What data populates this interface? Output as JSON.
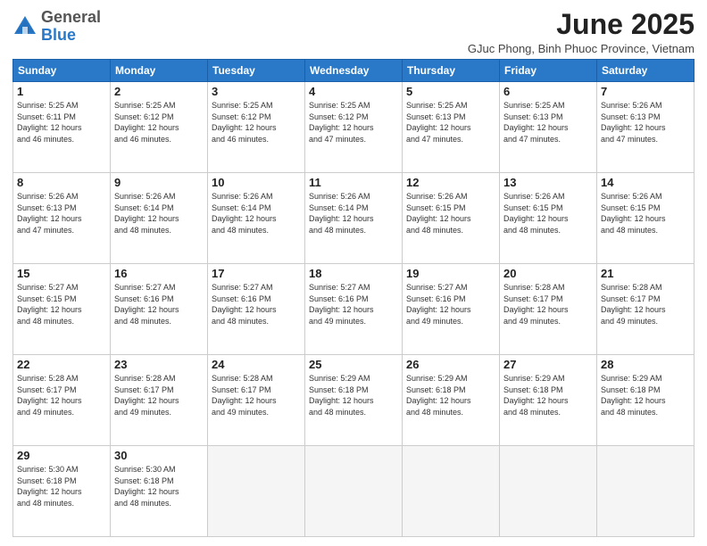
{
  "header": {
    "logo_general": "General",
    "logo_blue": "Blue",
    "month_title": "June 2025",
    "subtitle": "GJuc Phong, Binh Phuoc Province, Vietnam"
  },
  "days_of_week": [
    "Sunday",
    "Monday",
    "Tuesday",
    "Wednesday",
    "Thursday",
    "Friday",
    "Saturday"
  ],
  "weeks": [
    [
      {
        "day": "1",
        "info": "Sunrise: 5:25 AM\nSunset: 6:11 PM\nDaylight: 12 hours\nand 46 minutes."
      },
      {
        "day": "2",
        "info": "Sunrise: 5:25 AM\nSunset: 6:12 PM\nDaylight: 12 hours\nand 46 minutes."
      },
      {
        "day": "3",
        "info": "Sunrise: 5:25 AM\nSunset: 6:12 PM\nDaylight: 12 hours\nand 46 minutes."
      },
      {
        "day": "4",
        "info": "Sunrise: 5:25 AM\nSunset: 6:12 PM\nDaylight: 12 hours\nand 47 minutes."
      },
      {
        "day": "5",
        "info": "Sunrise: 5:25 AM\nSunset: 6:13 PM\nDaylight: 12 hours\nand 47 minutes."
      },
      {
        "day": "6",
        "info": "Sunrise: 5:25 AM\nSunset: 6:13 PM\nDaylight: 12 hours\nand 47 minutes."
      },
      {
        "day": "7",
        "info": "Sunrise: 5:26 AM\nSunset: 6:13 PM\nDaylight: 12 hours\nand 47 minutes."
      }
    ],
    [
      {
        "day": "8",
        "info": "Sunrise: 5:26 AM\nSunset: 6:13 PM\nDaylight: 12 hours\nand 47 minutes."
      },
      {
        "day": "9",
        "info": "Sunrise: 5:26 AM\nSunset: 6:14 PM\nDaylight: 12 hours\nand 48 minutes."
      },
      {
        "day": "10",
        "info": "Sunrise: 5:26 AM\nSunset: 6:14 PM\nDaylight: 12 hours\nand 48 minutes."
      },
      {
        "day": "11",
        "info": "Sunrise: 5:26 AM\nSunset: 6:14 PM\nDaylight: 12 hours\nand 48 minutes."
      },
      {
        "day": "12",
        "info": "Sunrise: 5:26 AM\nSunset: 6:15 PM\nDaylight: 12 hours\nand 48 minutes."
      },
      {
        "day": "13",
        "info": "Sunrise: 5:26 AM\nSunset: 6:15 PM\nDaylight: 12 hours\nand 48 minutes."
      },
      {
        "day": "14",
        "info": "Sunrise: 5:26 AM\nSunset: 6:15 PM\nDaylight: 12 hours\nand 48 minutes."
      }
    ],
    [
      {
        "day": "15",
        "info": "Sunrise: 5:27 AM\nSunset: 6:15 PM\nDaylight: 12 hours\nand 48 minutes."
      },
      {
        "day": "16",
        "info": "Sunrise: 5:27 AM\nSunset: 6:16 PM\nDaylight: 12 hours\nand 48 minutes."
      },
      {
        "day": "17",
        "info": "Sunrise: 5:27 AM\nSunset: 6:16 PM\nDaylight: 12 hours\nand 48 minutes."
      },
      {
        "day": "18",
        "info": "Sunrise: 5:27 AM\nSunset: 6:16 PM\nDaylight: 12 hours\nand 49 minutes."
      },
      {
        "day": "19",
        "info": "Sunrise: 5:27 AM\nSunset: 6:16 PM\nDaylight: 12 hours\nand 49 minutes."
      },
      {
        "day": "20",
        "info": "Sunrise: 5:28 AM\nSunset: 6:17 PM\nDaylight: 12 hours\nand 49 minutes."
      },
      {
        "day": "21",
        "info": "Sunrise: 5:28 AM\nSunset: 6:17 PM\nDaylight: 12 hours\nand 49 minutes."
      }
    ],
    [
      {
        "day": "22",
        "info": "Sunrise: 5:28 AM\nSunset: 6:17 PM\nDaylight: 12 hours\nand 49 minutes."
      },
      {
        "day": "23",
        "info": "Sunrise: 5:28 AM\nSunset: 6:17 PM\nDaylight: 12 hours\nand 49 minutes."
      },
      {
        "day": "24",
        "info": "Sunrise: 5:28 AM\nSunset: 6:17 PM\nDaylight: 12 hours\nand 49 minutes."
      },
      {
        "day": "25",
        "info": "Sunrise: 5:29 AM\nSunset: 6:18 PM\nDaylight: 12 hours\nand 48 minutes."
      },
      {
        "day": "26",
        "info": "Sunrise: 5:29 AM\nSunset: 6:18 PM\nDaylight: 12 hours\nand 48 minutes."
      },
      {
        "day": "27",
        "info": "Sunrise: 5:29 AM\nSunset: 6:18 PM\nDaylight: 12 hours\nand 48 minutes."
      },
      {
        "day": "28",
        "info": "Sunrise: 5:29 AM\nSunset: 6:18 PM\nDaylight: 12 hours\nand 48 minutes."
      }
    ],
    [
      {
        "day": "29",
        "info": "Sunrise: 5:30 AM\nSunset: 6:18 PM\nDaylight: 12 hours\nand 48 minutes."
      },
      {
        "day": "30",
        "info": "Sunrise: 5:30 AM\nSunset: 6:18 PM\nDaylight: 12 hours\nand 48 minutes."
      },
      {
        "day": "",
        "info": ""
      },
      {
        "day": "",
        "info": ""
      },
      {
        "day": "",
        "info": ""
      },
      {
        "day": "",
        "info": ""
      },
      {
        "day": "",
        "info": ""
      }
    ]
  ]
}
